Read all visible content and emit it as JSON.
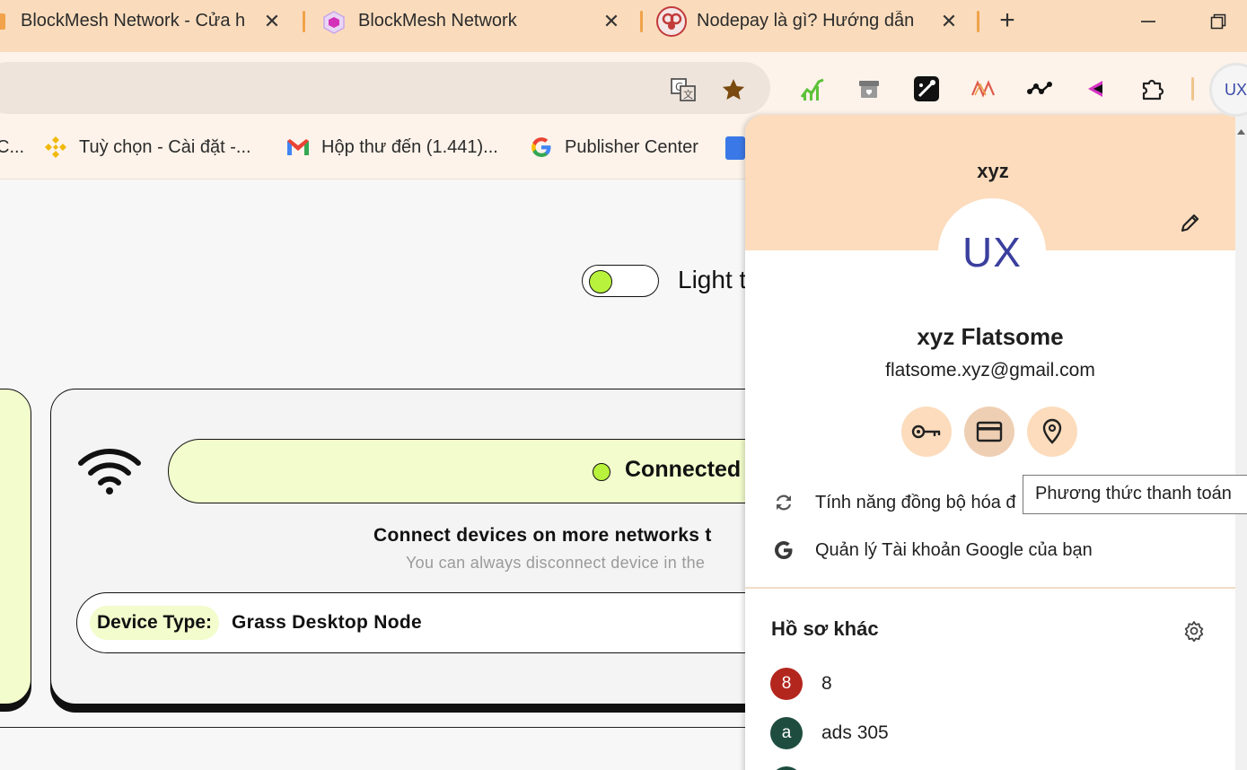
{
  "tabs": [
    {
      "title": "BlockMesh Network - Cửa h",
      "close": "✕"
    },
    {
      "title": "BlockMesh Network",
      "close": "✕"
    },
    {
      "title": "Nodepay là gì? Hướng dẫn",
      "close": "✕"
    }
  ],
  "new_tab": "+",
  "profile_button": {
    "initials": "UX"
  },
  "bookmarks": [
    {
      "label": "C..."
    },
    {
      "label": "Tuỳ chọn - Cài đặt -..."
    },
    {
      "label": "Hộp thư đến (1.441)..."
    },
    {
      "label": "Publisher Center"
    }
  ],
  "page": {
    "theme_label": "Light t",
    "status": "Connected",
    "connect_heading": "Connect devices on more networks t",
    "connect_sub": "You can always disconnect device in the",
    "device_type_label": "Device Type:",
    "device_type_value": "Grass Desktop Node"
  },
  "panel": {
    "header_name": "xyz",
    "avatar_initials": "UX",
    "full_name": "xyz Flatsome",
    "email": "flatsome.xyz@gmail.com",
    "sync_label": "Tính năng đồng bộ hóa đ",
    "manage_account_label": "Quản lý Tài khoản Google của bạn",
    "other_profiles_heading": "Hồ sơ khác",
    "other_profiles": [
      {
        "initial": "8",
        "name": "8",
        "color": "#b3261e"
      },
      {
        "initial": "a",
        "name": "ads 305",
        "color": "#1e4d3f"
      }
    ]
  },
  "tooltip": "Phương thức thanh toán",
  "colors": {
    "accent_green": "#b8f23c",
    "tab_strip": "#fadcbc",
    "panel_header": "#fcdcbc"
  }
}
